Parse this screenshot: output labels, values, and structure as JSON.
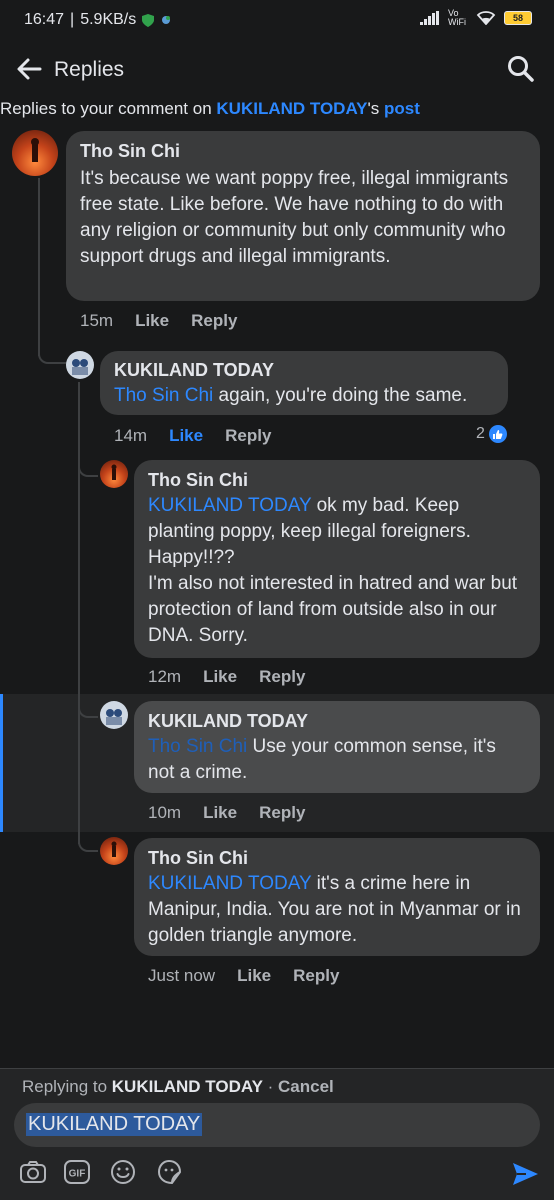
{
  "status_bar": {
    "time": "16:47",
    "speed": "5.9KB/s",
    "network_label": "Vo WiFi",
    "battery": "58"
  },
  "header": {
    "title": "Replies"
  },
  "context": {
    "prefix": "Replies to your comment on ",
    "page_name": "KUKILAND TODAY",
    "suffix": "'s",
    "post_link": "post"
  },
  "comments": [
    {
      "author": "Tho Sin Chi",
      "mention": "",
      "text": "It's because we want poppy free, illegal immigrants free state. Like before. We have nothing to do with any religion or community but only community who support drugs and illegal immigrants.",
      "time": "15m",
      "like_label": "Like",
      "reply_label": "Reply"
    },
    {
      "author": "KUKILAND TODAY",
      "mention": "Tho Sin Chi",
      "text": " again, you're doing the same.",
      "time": "14m",
      "like_label": "Like",
      "reply_label": "Reply",
      "reaction_count": "2"
    },
    {
      "author": "Tho Sin Chi",
      "mention": "KUKILAND TODAY",
      "text": " ok my bad. Keep planting poppy, keep illegal foreigners. Happy!!??",
      "text2": "I'm also not interested in hatred and war but protection of land from outside also in our DNA. Sorry.",
      "time": "12m",
      "like_label": "Like",
      "reply_label": "Reply"
    },
    {
      "author": "KUKILAND TODAY",
      "mention": "Tho Sin Chi",
      "text": " Use your common sense, it's not a crime.",
      "time": "10m",
      "like_label": "Like",
      "reply_label": "Reply"
    },
    {
      "author": "Tho Sin Chi",
      "mention": "KUKILAND TODAY",
      "text": " it's a crime here in Manipur, India. You are not in Myanmar or in golden triangle anymore.",
      "time": "Just now",
      "like_label": "Like",
      "reply_label": "Reply"
    }
  ],
  "composer": {
    "replying_prefix": "Replying to ",
    "replying_to": "KUKILAND TODAY",
    "cancel_label": "Cancel",
    "input_value": "KUKILAND TODAY",
    "tools": [
      "camera-icon",
      "gif-icon",
      "emoji-icon",
      "sticker-icon"
    ],
    "send": "send-icon"
  },
  "colors": {
    "background": "#18191a",
    "bubble": "#3a3b3c",
    "accent": "#2d88ff",
    "secondary_text": "#b0b3b8"
  }
}
